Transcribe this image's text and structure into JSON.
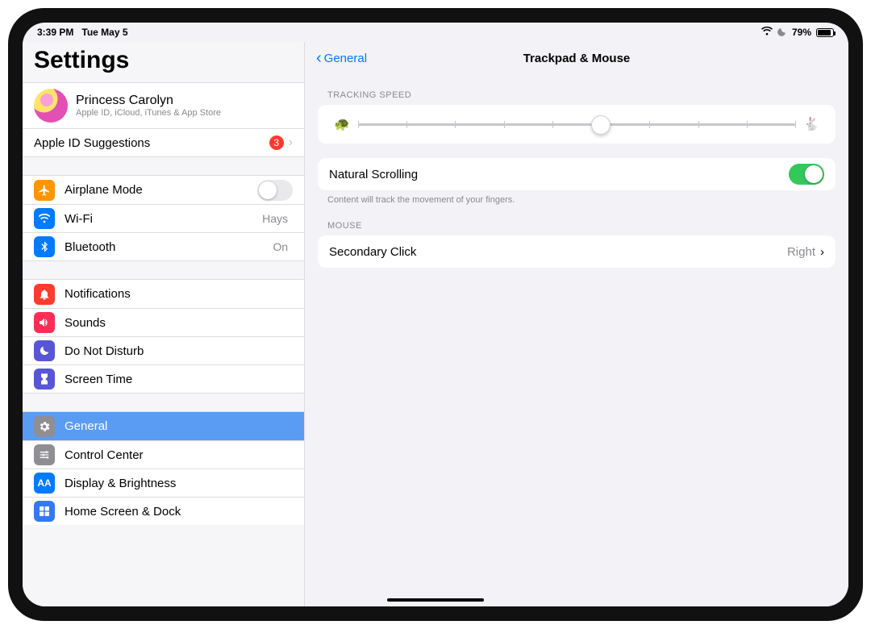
{
  "status": {
    "time": "3:39 PM",
    "date": "Tue May 5",
    "battery_pct": "79%"
  },
  "sidebar": {
    "title": "Settings",
    "user": {
      "name": "Princess Carolyn",
      "sub": "Apple ID, iCloud, iTunes & App Store"
    },
    "suggestion": {
      "label": "Apple ID Suggestions",
      "badge": "3"
    },
    "g1": [
      {
        "icon": "airplane",
        "color": "#ff9500",
        "label": "Airplane Mode",
        "switch": false
      },
      {
        "icon": "wifi",
        "color": "#007aff",
        "label": "Wi-Fi",
        "value": "Hays"
      },
      {
        "icon": "bluetooth",
        "color": "#007aff",
        "label": "Bluetooth",
        "value": "On"
      }
    ],
    "g2": [
      {
        "icon": "bell",
        "color": "#ff3b30",
        "label": "Notifications"
      },
      {
        "icon": "speaker",
        "color": "#ff2d55",
        "label": "Sounds"
      },
      {
        "icon": "moon",
        "color": "#5856d6",
        "label": "Do Not Disturb"
      },
      {
        "icon": "hourglass",
        "color": "#5856d6",
        "label": "Screen Time"
      }
    ],
    "g3": [
      {
        "icon": "gear",
        "color": "#8e8e93",
        "label": "General",
        "selected": true
      },
      {
        "icon": "sliders",
        "color": "#8e8e93",
        "label": "Control Center"
      },
      {
        "icon": "AA",
        "color": "#007aff",
        "label": "Display & Brightness"
      },
      {
        "icon": "grid",
        "color": "#3478f6",
        "label": "Home Screen & Dock"
      }
    ]
  },
  "detail": {
    "back": "General",
    "title": "Trackpad & Mouse",
    "tracking_header": "TRACKING SPEED",
    "tracking": {
      "ticks": 10,
      "value": 5
    },
    "scroll": {
      "label": "Natural Scrolling",
      "on": true,
      "note": "Content will track the movement of your fingers."
    },
    "mouse_header": "MOUSE",
    "secondary": {
      "label": "Secondary Click",
      "value": "Right"
    }
  }
}
